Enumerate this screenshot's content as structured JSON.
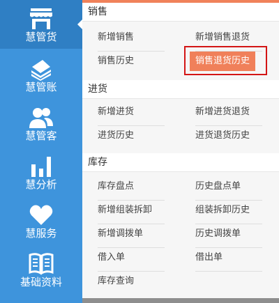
{
  "colors": {
    "sidebar_bg": "#3e94dc",
    "sidebar_active_bg": "#2f7fc4",
    "highlight_bg": "#f0805a",
    "callout_border": "#d31515",
    "section_body_bg": "#f6f6f6"
  },
  "sidebar": {
    "items": [
      {
        "label": "慧管货",
        "icon": "store-icon",
        "active": true
      },
      {
        "label": "慧管账",
        "icon": "money-icon",
        "active": false
      },
      {
        "label": "慧管客",
        "icon": "customers-icon",
        "active": false
      },
      {
        "label": "慧分析",
        "icon": "bar-chart-icon",
        "active": false
      },
      {
        "label": "慧服务",
        "icon": "heart-icon",
        "active": false
      },
      {
        "label": "基础资料",
        "icon": "book-icon",
        "active": false
      }
    ]
  },
  "menu": {
    "sales": {
      "title": "销售",
      "links": [
        "新增销售",
        "新增销售退货",
        "销售历史",
        "销售退货历史"
      ],
      "selected": "销售退货历史"
    },
    "purchase": {
      "title": "进货",
      "links": [
        "新增进货",
        "新增进货退货",
        "进货历史",
        "进货退货历史"
      ]
    },
    "inventory": {
      "title": "库存",
      "links": [
        "库存盘点",
        "历史盘点单",
        "新增组装拆卸",
        "组装拆卸历史",
        "新增调拨单",
        "历史调拨单",
        "借入单",
        "借出单",
        "库存查询"
      ]
    }
  }
}
